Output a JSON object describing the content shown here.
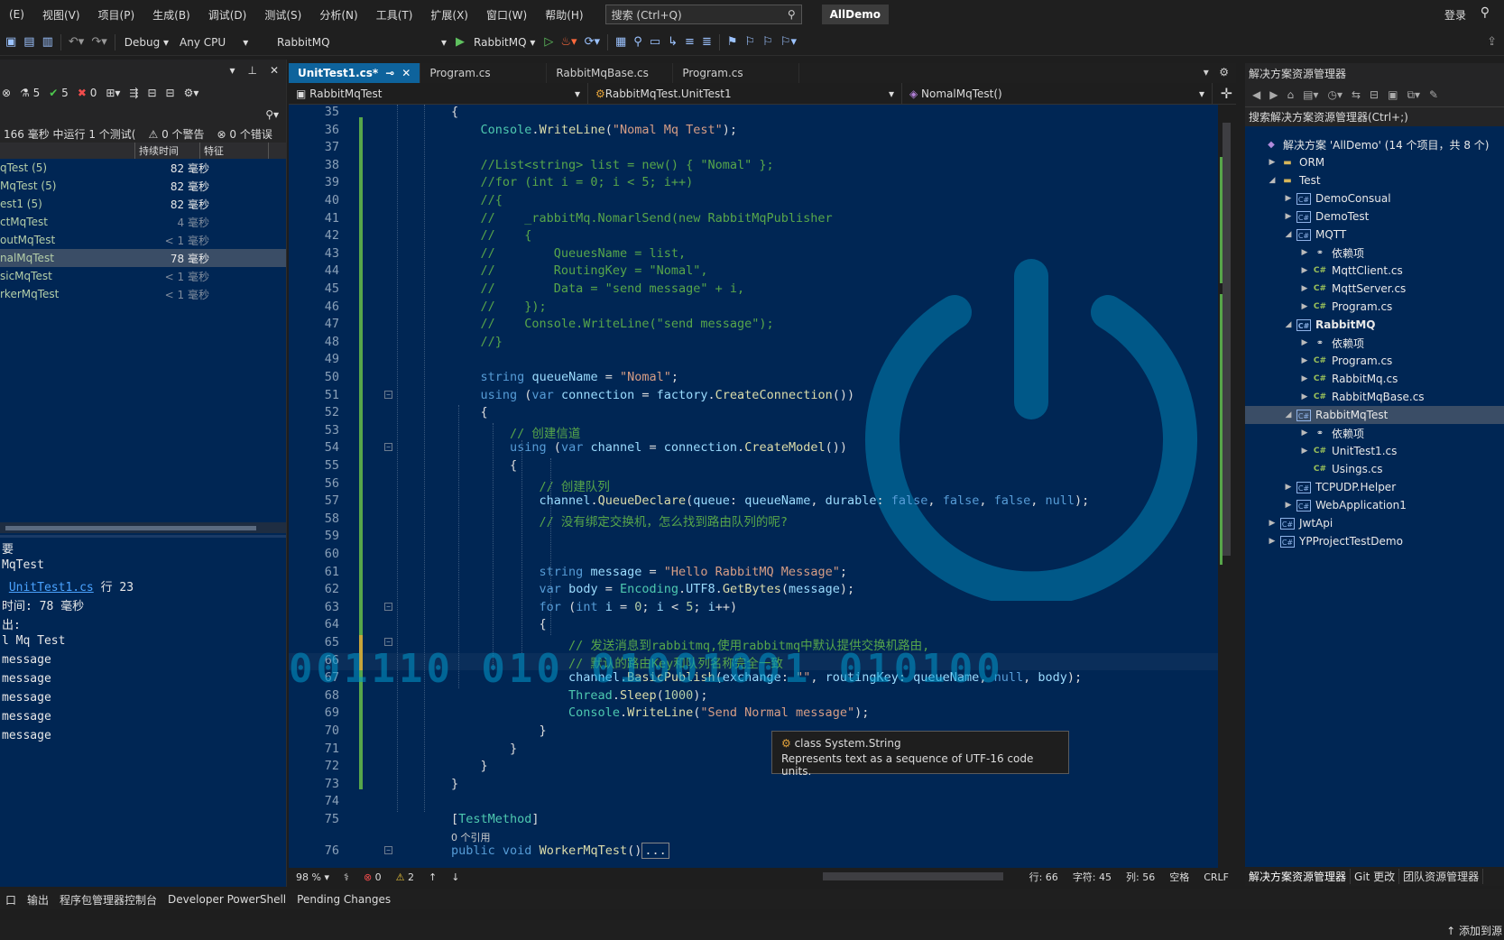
{
  "menu": {
    "items": [
      "(E)",
      "视图(V)",
      "项目(P)",
      "生成(B)",
      "调试(D)",
      "测试(S)",
      "分析(N)",
      "工具(T)",
      "扩展(X)",
      "窗口(W)",
      "帮助(H)"
    ],
    "search_label": "搜索 (Ctrl+Q)",
    "app_name": "AllDemo",
    "login": "登录"
  },
  "toolbar": {
    "config": "Debug",
    "platform": "Any CPU",
    "project": "RabbitMQ",
    "run_target": "RabbitMQ"
  },
  "test_explorer": {
    "counts": {
      "total": "5",
      "passed": "5",
      "failed": "0"
    },
    "summary": "166 毫秒 中运行 1 个测试(",
    "warnings": "0 个警告",
    "errors": "0 个错误",
    "columns": [
      "持续时间",
      "特征"
    ],
    "rows": [
      {
        "name": "qTest (5)",
        "duration": "82 毫秒",
        "dim": false
      },
      {
        "name": "MqTest (5)",
        "duration": "82 毫秒",
        "dim": false
      },
      {
        "name": "est1 (5)",
        "duration": "82 毫秒",
        "dim": false
      },
      {
        "name": "ctMqTest",
        "duration": "4 毫秒",
        "dim": true
      },
      {
        "name": "outMqTest",
        "duration": "< 1 毫秒",
        "dim": true
      },
      {
        "name": "nalMqTest",
        "duration": "78 毫秒",
        "dim": false,
        "selected": true
      },
      {
        "name": "sicMqTest",
        "duration": "< 1 毫秒",
        "dim": true
      },
      {
        "name": "rkerMqTest",
        "duration": "< 1 毫秒",
        "dim": true
      }
    ],
    "details": {
      "heading": "要",
      "test_name": "MqTest",
      "source_file": "UnitTest1.cs",
      "source_line": "行 23",
      "duration_line": "时间: 78 毫秒",
      "output_label": "出:",
      "output_lines": [
        "l Mq Test",
        " message",
        " message",
        " message",
        " message",
        " message"
      ]
    }
  },
  "editor": {
    "tabs": [
      {
        "label": "UnitTest1.cs*",
        "active": true
      },
      {
        "label": "Program.cs",
        "active": false
      },
      {
        "label": "RabbitMqBase.cs",
        "active": false
      },
      {
        "label": "Program.cs",
        "active": false
      }
    ],
    "nav": {
      "project": "RabbitMqTest",
      "class": "RabbitMqTest.UnitTest1",
      "member": "NomalMqTest()"
    },
    "references": "0 个引用",
    "tooltip": {
      "line1": "class System.String",
      "line2": "Represents text as a sequence of UTF-16 code units."
    },
    "watermark_text": "001110 010 01001001 010100",
    "status": {
      "zoom": "98 %",
      "errors": "0",
      "warnings": "2",
      "line": "行: 66",
      "char": "字符: 45",
      "col": "列: 56",
      "whitespace": "空格",
      "eol": "CRLF"
    }
  },
  "solution_explorer": {
    "title": "解决方案资源管理器",
    "search": "搜索解决方案资源管理器(Ctrl+;)",
    "nodes": [
      {
        "label": "解决方案 'AllDemo' (14 个项目，共 8 个)",
        "indent": 0,
        "arrow": "",
        "icon": "sln"
      },
      {
        "label": "ORM",
        "indent": 1,
        "arrow": "▶",
        "icon": "folder"
      },
      {
        "label": "Test",
        "indent": 1,
        "arrow": "◢",
        "icon": "folder"
      },
      {
        "label": "DemoConsual",
        "indent": 2,
        "arrow": "▶",
        "icon": "proj"
      },
      {
        "label": "DemoTest",
        "indent": 2,
        "arrow": "▶",
        "icon": "proj"
      },
      {
        "label": "MQTT",
        "indent": 2,
        "arrow": "◢",
        "icon": "proj"
      },
      {
        "label": "依赖项",
        "indent": 3,
        "arrow": "▶",
        "icon": "dep"
      },
      {
        "label": "MqttClient.cs",
        "indent": 3,
        "arrow": "▶",
        "icon": "cs"
      },
      {
        "label": "MqttServer.cs",
        "indent": 3,
        "arrow": "▶",
        "icon": "cs"
      },
      {
        "label": "Program.cs",
        "indent": 3,
        "arrow": "▶",
        "icon": "cs"
      },
      {
        "label": "RabbitMQ",
        "indent": 2,
        "arrow": "◢",
        "icon": "proj",
        "bold": true
      },
      {
        "label": "依赖项",
        "indent": 3,
        "arrow": "▶",
        "icon": "dep"
      },
      {
        "label": "Program.cs",
        "indent": 3,
        "arrow": "▶",
        "icon": "cs"
      },
      {
        "label": "RabbitMq.cs",
        "indent": 3,
        "arrow": "▶",
        "icon": "cs"
      },
      {
        "label": "RabbitMqBase.cs",
        "indent": 3,
        "arrow": "▶",
        "icon": "cs"
      },
      {
        "label": "RabbitMqTest",
        "indent": 2,
        "arrow": "◢",
        "icon": "proj",
        "selected": true
      },
      {
        "label": "依赖项",
        "indent": 3,
        "arrow": "▶",
        "icon": "dep"
      },
      {
        "label": "UnitTest1.cs",
        "indent": 3,
        "arrow": "▶",
        "icon": "cs"
      },
      {
        "label": "Usings.cs",
        "indent": 3,
        "arrow": "",
        "icon": "cs"
      },
      {
        "label": "TCPUDP.Helper",
        "indent": 2,
        "arrow": "▶",
        "icon": "proj"
      },
      {
        "label": "WebApplication1",
        "indent": 2,
        "arrow": "▶",
        "icon": "proj"
      },
      {
        "label": "JwtApi",
        "indent": 1,
        "arrow": "▶",
        "icon": "proj"
      },
      {
        "label": "YPProjectTestDemo",
        "indent": 1,
        "arrow": "▶",
        "icon": "proj"
      }
    ],
    "bottom_tabs": [
      "解决方案资源管理器",
      "Git 更改",
      "团队资源管理器"
    ]
  },
  "bottom_tabs": [
    "口",
    "输出",
    "程序包管理器控制台",
    "Developer PowerShell",
    "Pending Changes"
  ],
  "status_right": "添加到源"
}
